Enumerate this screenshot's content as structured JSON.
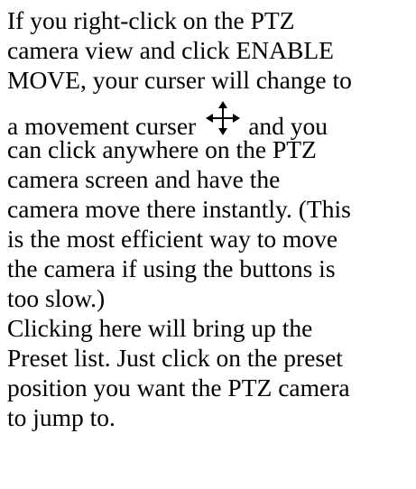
{
  "paragraph_1": {
    "lines": [
      "If you right-click on the PTZ",
      "camera view and click ENABLE",
      "MOVE, your curser will change to",
      "a movement curser",
      "and you",
      "can click anywhere on the PTZ",
      "camera screen and have the",
      "camera move there instantly. (This",
      "is the most efficient way to move",
      "the camera if using the buttons is",
      "too slow.)"
    ],
    "icon": "move-cursor-icon"
  },
  "paragraph_2": {
    "lines": [
      "Clicking here will bring up the",
      "Preset list. Just click on the preset",
      "position you want the PTZ camera",
      "to jump to."
    ]
  }
}
